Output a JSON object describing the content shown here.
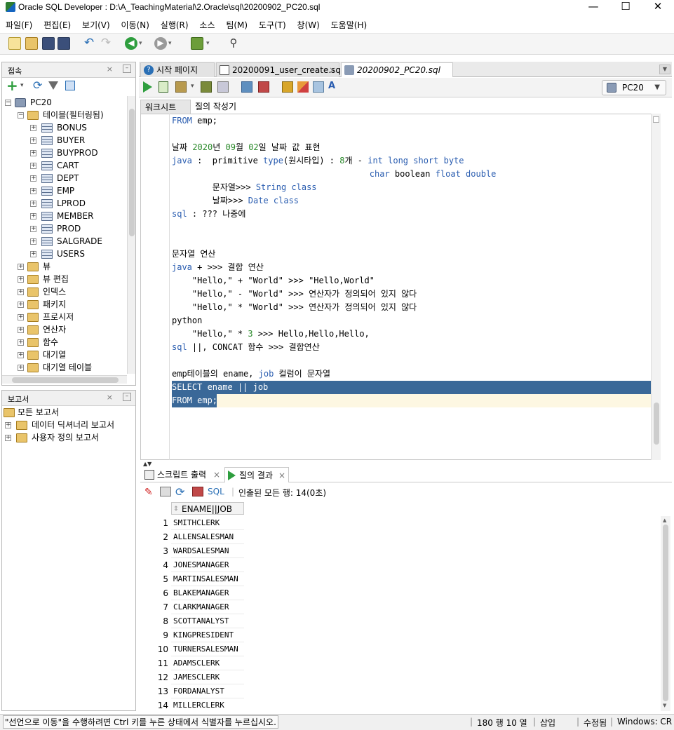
{
  "window": {
    "title": "Oracle SQL Developer : D:\\A_TeachingMaterial\\2.Oracle\\sql\\20200902_PC20.sql",
    "minimize": "—",
    "maximize": "☐",
    "close": "✕"
  },
  "menu": [
    "파일(F)",
    "편집(E)",
    "보기(V)",
    "이동(N)",
    "실행(R)",
    "소스",
    "팀(M)",
    "도구(T)",
    "창(W)",
    "도움말(H)"
  ],
  "connections_panel": {
    "title": "접속",
    "root": "PC20",
    "tables_folder": "테이블(필터링됨)",
    "tables": [
      "BONUS",
      "BUYER",
      "BUYPROD",
      "CART",
      "DEPT",
      "EMP",
      "LPROD",
      "MEMBER",
      "PROD",
      "SALGRADE",
      "USERS"
    ],
    "folders": [
      "뷰",
      "뷰 편집",
      "인덱스",
      "패키지",
      "프로시저",
      "연산자",
      "함수",
      "대기열",
      "대기열 테이블"
    ]
  },
  "reports_panel": {
    "title": "보고서",
    "items": [
      "모든 보고서",
      "데이터 딕셔너리 보고서",
      "사용자 정의 보고서"
    ]
  },
  "editor_tabs": [
    "시작 페이지",
    "20200091_user_create.sql",
    "20200902_PC20.sql"
  ],
  "connection_combo": "PC20",
  "sub_tabs": [
    "워크시트",
    "질의 작성기"
  ],
  "output_tabs": [
    "스크립트 출력",
    "질의 결과"
  ],
  "output_toolbar": {
    "sql_label": "SQL",
    "fetch_status": "인출된 모든 행: 14(0초)"
  },
  "result_grid": {
    "column": "ENAME||JOB",
    "rows": [
      "SMITHCLERK",
      "ALLENSALESMAN",
      "WARDSALESMAN",
      "JONESMANAGER",
      "MARTINSALESMAN",
      "BLAKEMANAGER",
      "CLARKMANAGER",
      "SCOTTANALYST",
      "KINGPRESIDENT",
      "TURNERSALESMAN",
      "ADAMSCLERK",
      "JAMESCLERK",
      "FORDANALYST",
      "MILLERCLERK"
    ]
  },
  "status": {
    "message": "\"선언으로 이동\"을 수행하려면 Ctrl 키를 누른 상태에서 식별자를 누르십시오.",
    "position": "180 행 10 열",
    "mode": "삽입",
    "modified": "수정됨",
    "eol": "Windows: CR"
  },
  "colors": {
    "keyword": "#2a5db0",
    "number": "#2a8a2a",
    "selection": "#3a6898",
    "current_line": "#fdf7e2"
  }
}
